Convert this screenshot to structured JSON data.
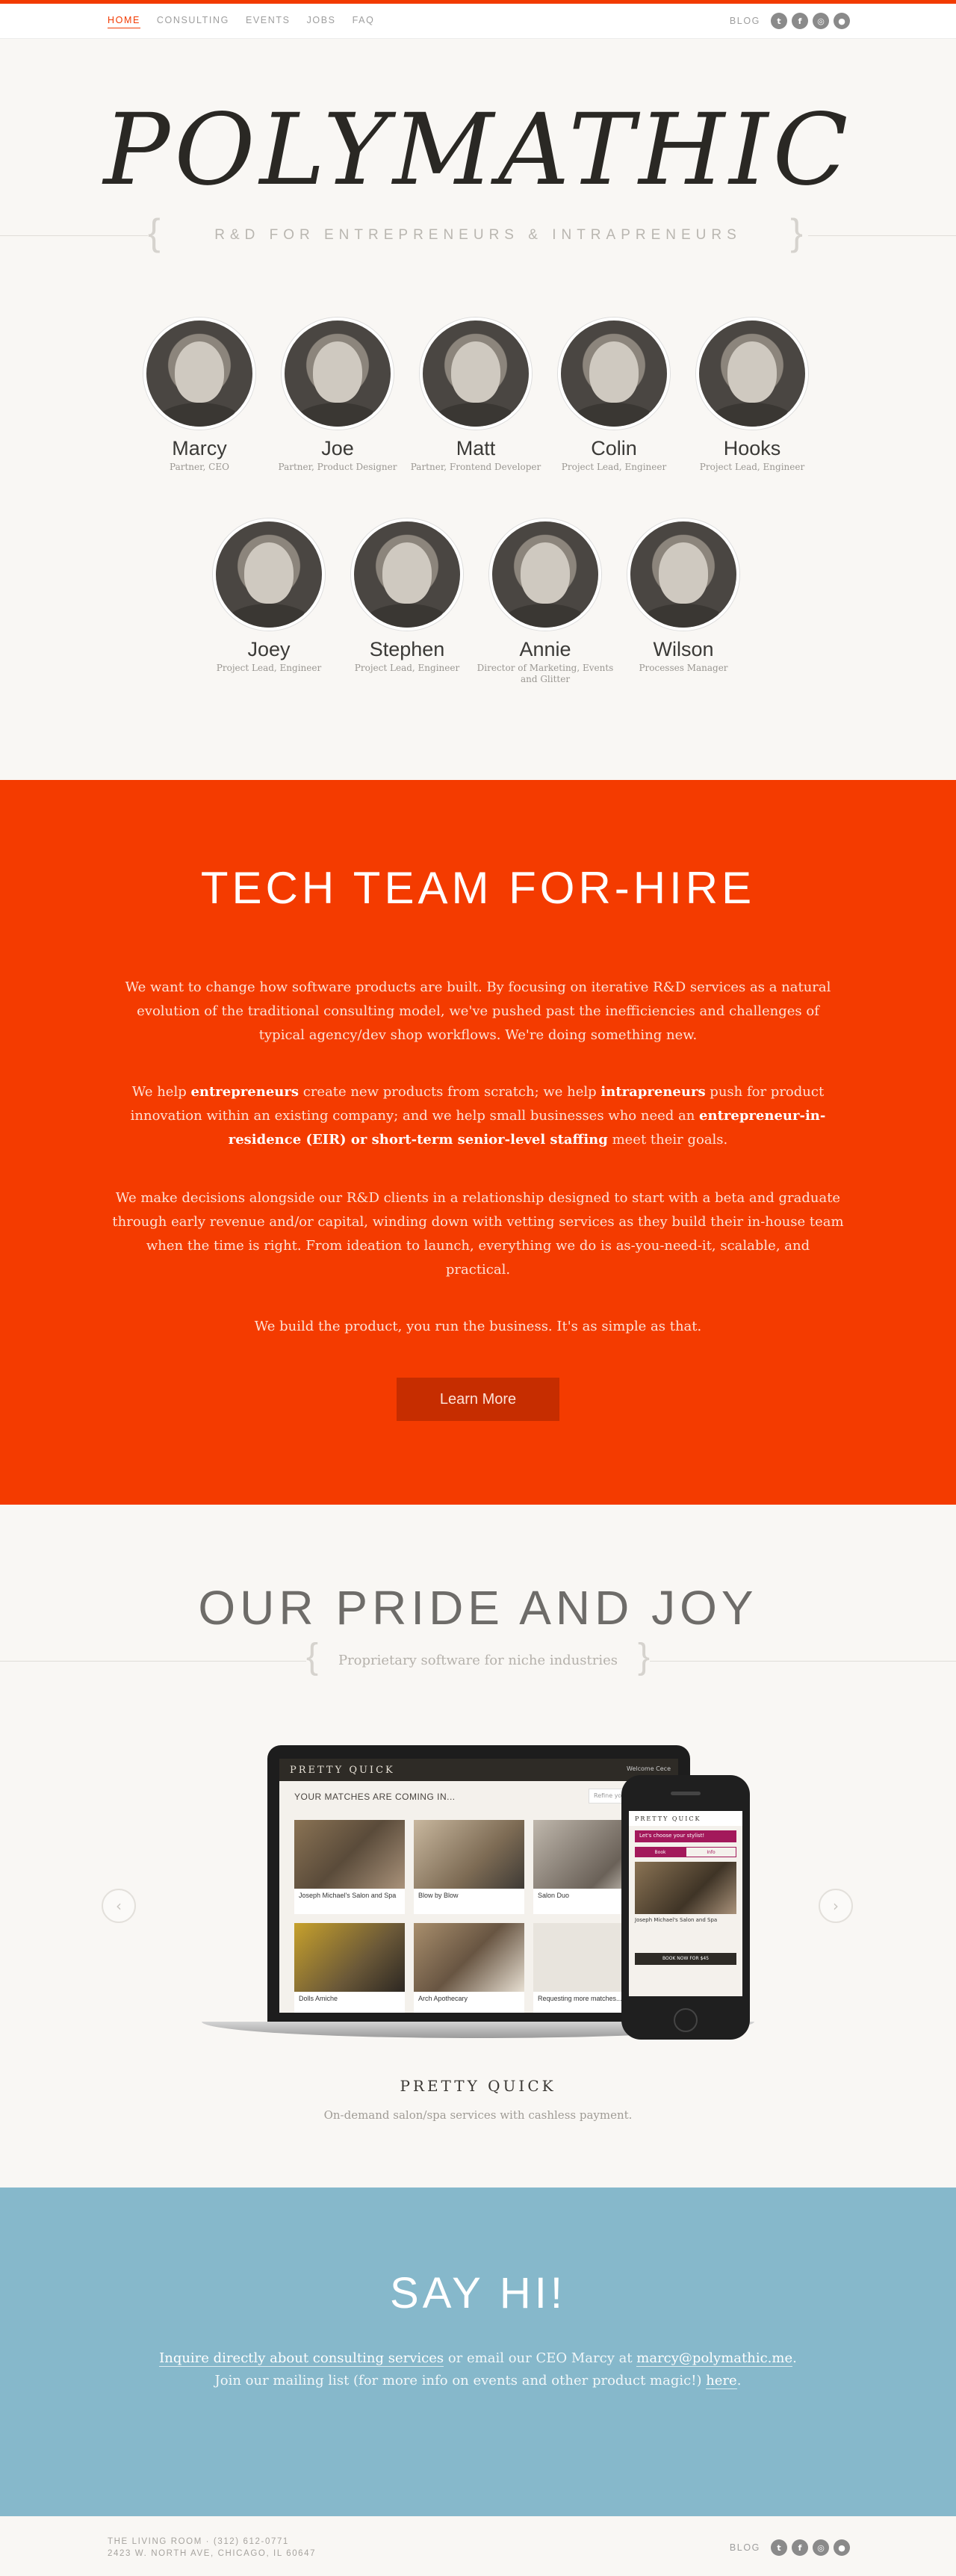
{
  "nav": {
    "links": [
      "HOME",
      "CONSULTING",
      "EVENTS",
      "JOBS",
      "FAQ"
    ],
    "blog": "BLOG",
    "social_icons": [
      "twitter-icon",
      "facebook-icon",
      "instagram-icon",
      "github-icon"
    ]
  },
  "hero": {
    "title": "POLYMATHIC",
    "subtitle": "R&D FOR ENTREPRENEURS & INTRAPRENEURS"
  },
  "team": [
    {
      "name": "Marcy",
      "role": "Partner, CEO"
    },
    {
      "name": "Joe",
      "role": "Partner, Product Designer"
    },
    {
      "name": "Matt",
      "role": "Partner, Frontend Developer"
    },
    {
      "name": "Colin",
      "role": "Project Lead, Engineer"
    },
    {
      "name": "Hooks",
      "role": "Project Lead, Engineer"
    },
    {
      "name": "Joey",
      "role": "Project Lead, Engineer"
    },
    {
      "name": "Stephen",
      "role": "Project Lead, Engineer"
    },
    {
      "name": "Annie",
      "role": "Director of Marketing, Events and Glitter"
    },
    {
      "name": "Wilson",
      "role": "Processes Manager"
    }
  ],
  "hire": {
    "title": "TECH TEAM FOR-HIRE",
    "p1": "We want to change how software products are built. By focusing on iterative R&D services as a natural evolution of the traditional consulting model, we've pushed past the inefficiencies and challenges of typical agency/dev shop workflows. We're doing something new.",
    "p2_a": "We help ",
    "p2_b": "entrepreneurs",
    "p2_c": " create new products from scratch; we help ",
    "p2_d": "intrapreneurs",
    "p2_e": " push for product innovation within an existing company; and we help small businesses who need an ",
    "p2_f": "entrepreneur-in-residence (EIR) or short-term senior-level staffing",
    "p2_g": " meet their goals.",
    "p3": "We make decisions alongside our R&D clients in a relationship designed to start with a beta and graduate through early revenue and/or capital, winding down with vetting services as they build their in-house team when the time is right. From ideation to launch, everything we do is as-you-need-it, scalable, and practical.",
    "p4": "We build the product, you run the business. It's as simple as that.",
    "button": "Learn More"
  },
  "pride": {
    "title": "OUR PRIDE AND JOY",
    "subtitle": "Proprietary software for niche industries",
    "prev_arrow": "‹",
    "next_arrow": "›",
    "product_logo": "PRETTY QUICK",
    "product_desc": "On-demand salon/spa services with cashless payment.",
    "mock": {
      "logo": "PRETTY QUICK",
      "welcome": "Welcome Cece",
      "heading": "YOUR MATCHES ARE COMING IN...",
      "search": "Refine your search",
      "tiles": [
        "Joseph Michael's Salon and Spa",
        "Blow by Blow",
        "Salon Duo",
        "Dolls Amiche",
        "Arch Apothecary",
        "Requesting more matches..."
      ],
      "phone_logo": "PRETTY QUICK",
      "phone_banner": "Let's choose your stylist!",
      "phone_tabs": [
        "Book",
        "Info"
      ],
      "phone_tile": "Joseph Michael's Salon and Spa",
      "phone_button": "BOOK NOW FOR $45"
    }
  },
  "sayhi": {
    "title": "SAY HI!",
    "link1": "Inquire directly about consulting services",
    "mid1": " or email our CEO Marcy at ",
    "email": "marcy@polymathic.me",
    "end1": ".",
    "line2_a": "Join our mailing list (for more info on events and other product magic!) ",
    "link2": "here",
    "end2": "."
  },
  "footer": {
    "line1": "THE LIVING ROOM · (312) 612-0771",
    "line2": "2423 W. NORTH AVE, CHICAGO, IL 60647",
    "blog": "BLOG"
  }
}
